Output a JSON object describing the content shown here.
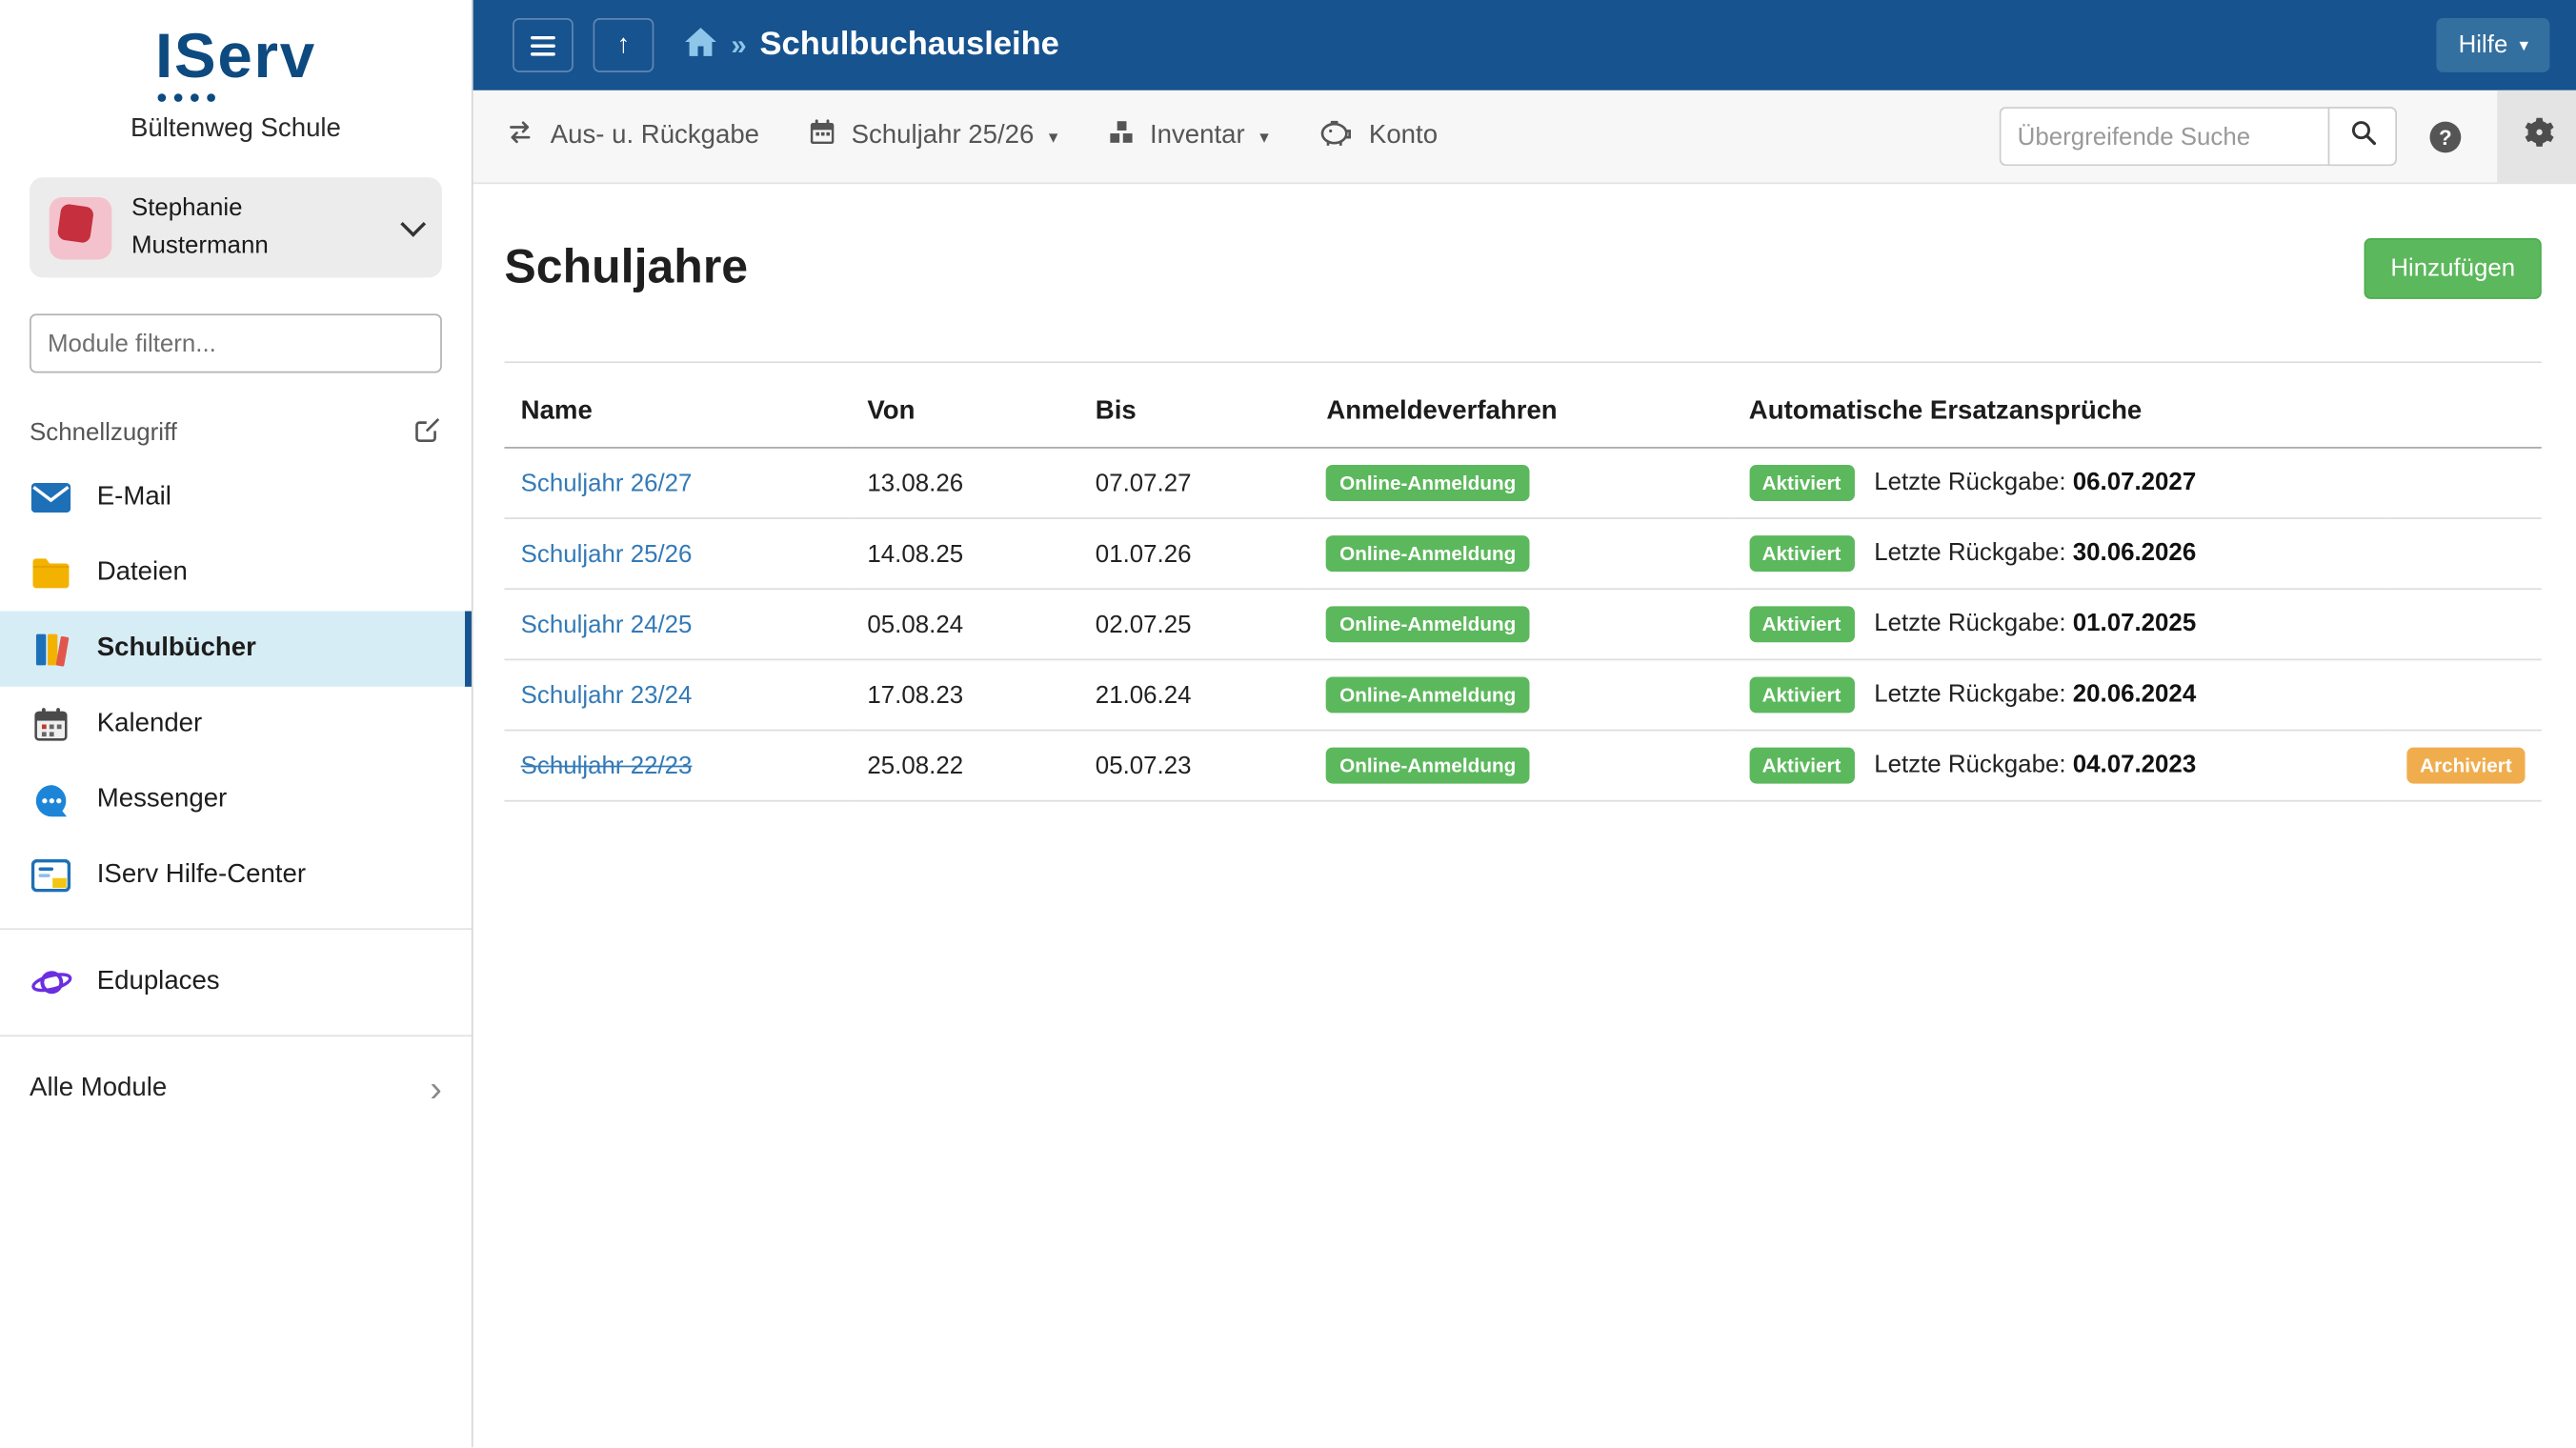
{
  "colors": {
    "header_blue": "#17538f",
    "success_green": "#5cb85c",
    "warning_orange": "#f0ad4e",
    "link_blue": "#337ab7",
    "active_item_bg": "#d7edf6"
  },
  "glyphs": {
    "breadcrumb_sep": "»",
    "caret_down": "▾",
    "chevron_right": "›",
    "up_arrow": "↑",
    "question_mark": "?"
  },
  "sidebar": {
    "logo_text": "IServ",
    "school_name": "Bültenweg Schule",
    "user": {
      "name_line1": "Stephanie",
      "name_line2": "Mustermann"
    },
    "filter_placeholder": "Module filtern...",
    "quick_access_label": "Schnellzugriff",
    "items": [
      {
        "label": "E-Mail",
        "icon": "email-icon"
      },
      {
        "label": "Dateien",
        "icon": "folder-icon"
      },
      {
        "label": "Schulbücher",
        "icon": "books-icon",
        "active": true
      },
      {
        "label": "Kalender",
        "icon": "calendar-icon"
      },
      {
        "label": "Messenger",
        "icon": "messenger-icon"
      },
      {
        "label": "IServ Hilfe-Center",
        "icon": "help-center-icon"
      }
    ],
    "extra_items": [
      {
        "label": "Eduplaces",
        "icon": "planet-icon"
      }
    ],
    "all_modules_label": "Alle Module"
  },
  "header": {
    "breadcrumb_title": "Schulbuchausleihe",
    "help_label": "Hilfe"
  },
  "toolbar": {
    "items": [
      {
        "label": "Aus- u. Rückgabe",
        "icon": "exchange-icon",
        "dropdown": false
      },
      {
        "label": "Schuljahr 25/26",
        "icon": "calendar-icon",
        "dropdown": true
      },
      {
        "label": "Inventar",
        "icon": "inventory-icon",
        "dropdown": true
      },
      {
        "label": "Konto",
        "icon": "piggy-bank-icon",
        "dropdown": false
      }
    ],
    "search_placeholder": "Übergreifende Suche"
  },
  "main": {
    "title": "Schuljahre",
    "add_button_label": "Hinzufügen",
    "table": {
      "headers": [
        "Name",
        "Von",
        "Bis",
        "Anmeldeverfahren",
        "Automatische Ersatzansprüche"
      ],
      "rueckgabe_label": "Letzte Rückgabe:",
      "rows": [
        {
          "name": "Schuljahr 26/27",
          "von": "13.08.26",
          "bis": "07.07.27",
          "anmeldeverfahren": "Online-Anmeldung",
          "status": "Aktiviert",
          "rueckgabe_date": "06.07.2027",
          "archived": ""
        },
        {
          "name": "Schuljahr 25/26",
          "von": "14.08.25",
          "bis": "01.07.26",
          "anmeldeverfahren": "Online-Anmeldung",
          "status": "Aktiviert",
          "rueckgabe_date": "30.06.2026",
          "archived": ""
        },
        {
          "name": "Schuljahr 24/25",
          "von": "05.08.24",
          "bis": "02.07.25",
          "anmeldeverfahren": "Online-Anmeldung",
          "status": "Aktiviert",
          "rueckgabe_date": "01.07.2025",
          "archived": ""
        },
        {
          "name": "Schuljahr 23/24",
          "von": "17.08.23",
          "bis": "21.06.24",
          "anmeldeverfahren": "Online-Anmeldung",
          "status": "Aktiviert",
          "rueckgabe_date": "20.06.2024",
          "archived": ""
        },
        {
          "name": "Schuljahr 22/23",
          "von": "25.08.22",
          "bis": "05.07.23",
          "anmeldeverfahren": "Online-Anmeldung",
          "status": "Aktiviert",
          "rueckgabe_date": "04.07.2023",
          "archived": "Archiviert",
          "strikethrough": true
        }
      ]
    }
  }
}
